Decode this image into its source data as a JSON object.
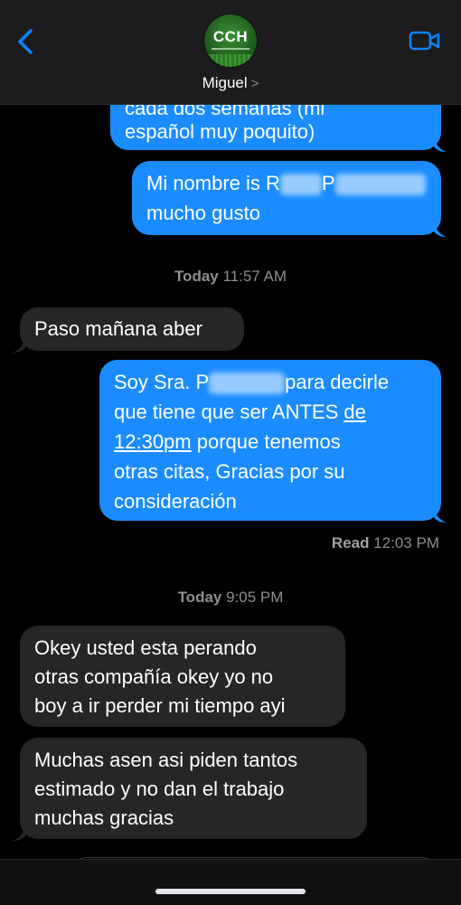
{
  "header": {
    "contact_name": "Miguel",
    "chevron": ">",
    "avatar_text": "CCH"
  },
  "messages": {
    "m1_partial": "español muy poquito)",
    "m1_top_cut": "cada dos semanas (mi",
    "m2_line1_a": "Mi nombre is R",
    "m2_line1_b": "P",
    "m2_line2": "mucho gusto",
    "stamp1_day": "Today",
    "stamp1_time": "11:57 AM",
    "m3": "Paso mañana aber",
    "m4_line1_a": "Soy Sra. P",
    "m4_line1_b": "para decirle",
    "m4_line2_a": "que tiene que ser ANTES ",
    "m4_line2_b": "de",
    "m4_line3_a": "12:30pm",
    "m4_line3_b": " porque tenemos",
    "m4_line4": "otras citas, Gracias por su",
    "m4_line5": "consideración",
    "read_label": "Read",
    "read_time": "12:03 PM",
    "stamp2_day": "Today",
    "stamp2_time": "9:05 PM",
    "m5_line1": "Okey usted esta perando",
    "m5_line2": "otras compañía okey yo no",
    "m5_line3": "boy a ir perder mi tiempo ayi",
    "m6_line1": "Muchas asen asi piden tantos",
    "m6_line2": "estimado y no dan el trabajo",
    "m6_line3": "muchas gracias"
  },
  "icons": {
    "back": "back-chevron-icon",
    "video": "video-camera-icon"
  },
  "colors": {
    "outgoing": "#1a8cff",
    "incoming": "#262629",
    "accent": "#0a84ff"
  }
}
